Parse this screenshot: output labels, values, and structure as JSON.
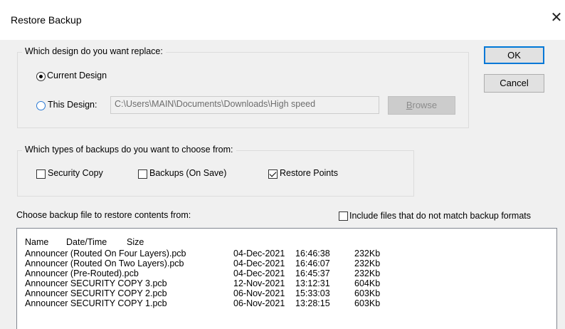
{
  "window": {
    "title": "Restore Backup",
    "close_glyph": "✕"
  },
  "design_group": {
    "legend": "Which design do you want replace:",
    "current_design_label": "Current Design",
    "current_design_selected": true,
    "this_design_label": "This Design:",
    "this_design_selected": false,
    "path_value": "C:\\Users\\MAIN\\Documents\\Downloads\\High speed",
    "browse_label_prefix": "",
    "browse_label_underline": "B",
    "browse_label_rest": "rowse"
  },
  "buttons": {
    "ok": "OK",
    "cancel": "Cancel"
  },
  "types_group": {
    "legend": "Which types of backups do you want to choose from:",
    "options": [
      {
        "label": "Security Copy",
        "checked": false
      },
      {
        "label": "Backups (On Save)",
        "checked": false
      },
      {
        "label": "Restore Points",
        "checked": true
      }
    ]
  },
  "choose_label": "Choose backup file to restore contents from:",
  "include_label": "Include files that do not match backup formats",
  "include_checked": false,
  "list": {
    "columns": [
      "Name",
      "Date/Time",
      "Size"
    ],
    "rows": [
      {
        "name": "Announcer (Routed On  Four Layers).pcb",
        "date": "04-Dec-2021",
        "time": "16:46:38",
        "size": "232Kb"
      },
      {
        "name": "Announcer (Routed On Two Layers).pcb",
        "date": "04-Dec-2021",
        "time": "16:46:07",
        "size": "232Kb"
      },
      {
        "name": "Announcer (Pre-Routed).pcb",
        "date": "04-Dec-2021",
        "time": "16:45:37",
        "size": "232Kb"
      },
      {
        "name": "Announcer SECURITY COPY 3.pcb",
        "date": "12-Nov-2021",
        "time": "13:12:31",
        "size": "604Kb"
      },
      {
        "name": "Announcer SECURITY COPY 2.pcb",
        "date": "06-Nov-2021",
        "time": "15:33:03",
        "size": "603Kb"
      },
      {
        "name": "Announcer SECURITY COPY 1.pcb",
        "date": "06-Nov-2021",
        "time": "13:28:15",
        "size": "603Kb"
      }
    ]
  }
}
